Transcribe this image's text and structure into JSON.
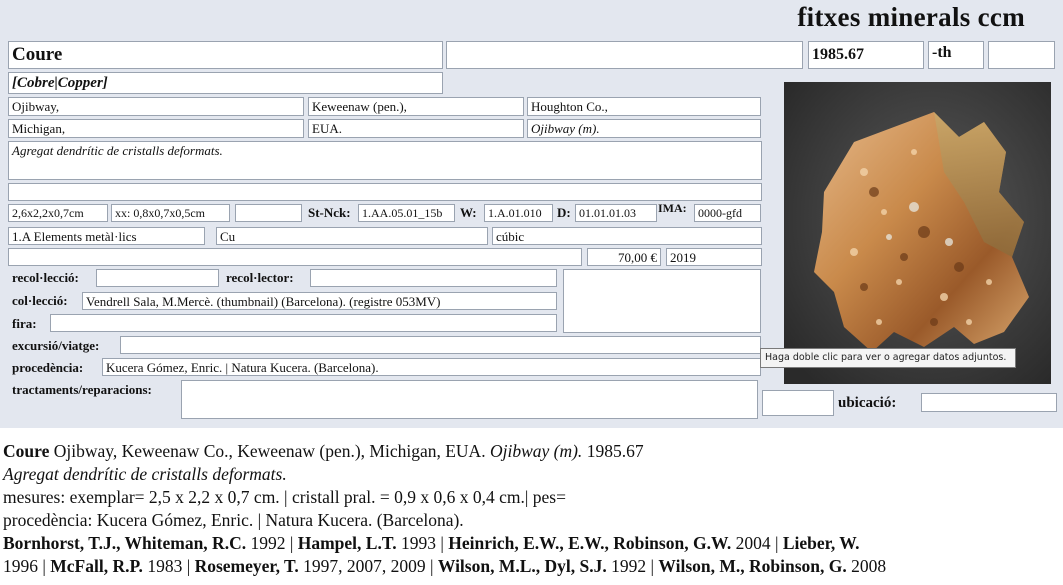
{
  "brand": "fitxes minerals ccm",
  "card": {
    "name": "Coure",
    "synonyms": "[Cobre|Copper]",
    "blank_top": "",
    "number": "1985.67",
    "suffix": "-th",
    "extra": "",
    "locality1": "Ojibway,",
    "locality2": "Keweenaw (pen.),",
    "locality3": "Houghton Co.,",
    "locality4": "Michigan,",
    "locality5": "EUA.",
    "locality6": "Ojibway (m).",
    "description": "Agregat dendrític de cristalls deformats.",
    "blank_line": "",
    "size_specimen": "2,6x2,2x0,7cm",
    "size_crystal": "xx: 0,8x0,7x0,5cm",
    "size_blank": "",
    "strunz_label": "St-Nck:",
    "strunz": "1.AA.05.01_15b",
    "w_label": "W:",
    "w_code": "1.A.01.010",
    "d_label": "D:",
    "d_code": "01.01.01.03",
    "ima_label": "IMA:",
    "ima": "0000-gfd",
    "class": "1.A Elements metàl·lics",
    "formula": "Cu",
    "system": "cúbic",
    "price": "70,00 €",
    "year": "2019",
    "recoleccio_label": "recol·lecció:",
    "recoleccio": "",
    "recolector_label": "recol·lector:",
    "recolector": "",
    "colleccio_label": "col·lecció:",
    "colleccio": "Vendrell Sala, M.Mercè. (thumbnail) (Barcelona). (registre 053MV)",
    "fira_label": "fira:",
    "fira": "",
    "excursio_label": "excursió/viatge:",
    "excursio": "",
    "procedencia_label": "procedència:",
    "procedencia": "Kucera Gómez, Enric. | Natura Kucera. (Barcelona).",
    "tractaments_label": "tractaments/reparacions:",
    "tractaments": "",
    "ubicacio_label": "ubicació:",
    "ubicacio": ""
  },
  "photo_tooltip": "Haga doble clic para ver o agregar datos adjuntos.",
  "summary": {
    "name": "Coure",
    "locality": " Ojibway, Keweenaw Co., Keweenaw (pen.), Michigan, EUA. ",
    "locality_italic": "Ojibway (m).",
    "number": " 1985.67",
    "description": "Agregat dendrític de cristalls deformats.",
    "measures": "mesures: exemplar= 2,5 x 2,2 x 0,7 cm. | cristall pral. = 0,9 x 0,6 x 0,4 cm.| pes=",
    "provenance": "procedència:  Kucera Gómez, Enric. | Natura Kucera. (Barcelona).",
    "refs": [
      {
        "a": "Bornhorst, T.J., Whiteman, R.C.",
        "y": " 1992 | "
      },
      {
        "a": "Hampel, L.T.",
        "y": " 1993 | "
      },
      {
        "a": "Heinrich, E.W., E.W., Robinson, G.W.",
        "y": " 2004 | "
      },
      {
        "a": "Lieber, W.",
        "y": ""
      }
    ],
    "refs2": [
      {
        "a": "",
        "y": "1996 | "
      },
      {
        "a": "McFall, R.P.",
        "y": " 1983 | "
      },
      {
        "a": "Rosemeyer, T.",
        "y": " 1997, 2007, 2009 | "
      },
      {
        "a": "Wilson, M.L., Dyl, S.J.",
        "y": " 1992 | "
      },
      {
        "a": "Wilson, M., Robinson, G.",
        "y": " 2008"
      }
    ]
  },
  "colors": {
    "panel": "#e3e7ef",
    "border": "#9aa3b0",
    "photo_bg": "#3a3a3a",
    "copper": "#c98a4b"
  },
  "icons": {
    "photo": "copper-mineral-photo"
  }
}
